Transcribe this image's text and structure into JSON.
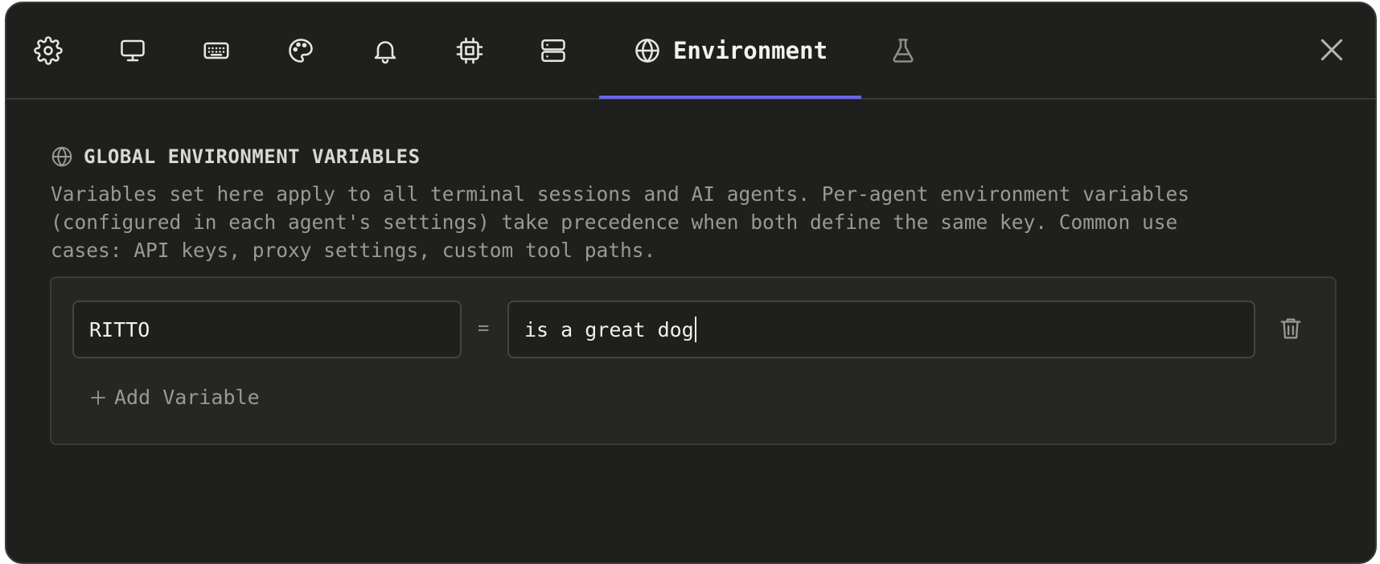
{
  "tabs": [
    {
      "icon": "gear-icon"
    },
    {
      "icon": "monitor-icon"
    },
    {
      "icon": "keyboard-icon"
    },
    {
      "icon": "palette-icon"
    },
    {
      "icon": "bell-icon"
    },
    {
      "icon": "cpu-icon"
    },
    {
      "icon": "server-icon"
    },
    {
      "icon": "globe-icon",
      "label": "Environment",
      "active": true
    },
    {
      "icon": "flask-icon"
    }
  ],
  "active_tab_label": "Environment",
  "section": {
    "title": "GLOBAL ENVIRONMENT VARIABLES",
    "description_lines": [
      "Variables set here apply to all terminal sessions and AI agents. Per-agent environment variables",
      "(configured in each agent's settings) take precedence when both define the same key. Common use",
      "cases: API keys, proxy settings, custom tool paths."
    ]
  },
  "variables": [
    {
      "key": "RITTO",
      "value": "is a great dog"
    }
  ],
  "equals_sign": "=",
  "add_variable_label": "Add Variable",
  "colors": {
    "background": "#1f1f1d",
    "panel": "#262623",
    "accent": "#6a66e8",
    "text": "#f0f0ec",
    "muted": "#9a9a94"
  }
}
